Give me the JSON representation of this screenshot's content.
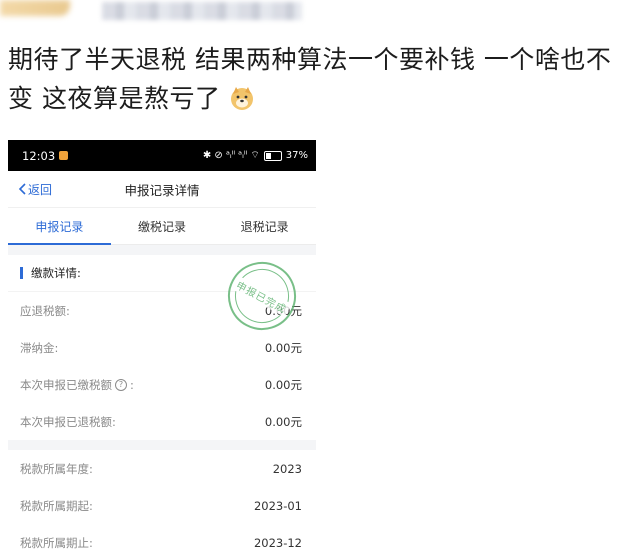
{
  "post": {
    "text": "期待了半天退税 结果两种算法一个要补钱  一个啥也不变 这夜算是熬亏了"
  },
  "statusbar": {
    "time": "12:03",
    "icons": "✱ ⊘ ᵃᵢˡˡ ᵃᵢˡˡ ⌔",
    "battery": "37%"
  },
  "navbar": {
    "back_label": "返回",
    "title": "申报记录详情"
  },
  "tabs": [
    {
      "label": "申报记录",
      "active": true
    },
    {
      "label": "缴税记录",
      "active": false
    },
    {
      "label": "退税记录",
      "active": false
    }
  ],
  "section": {
    "title": "缴款详情:"
  },
  "stamp": {
    "text": "申报已完成"
  },
  "rows": [
    {
      "key": "应退税额:",
      "value": "0.00元"
    },
    {
      "key": "滞纳金:",
      "value": "0.00元"
    },
    {
      "key": "本次申报已缴税额",
      "suffix": ":",
      "value": "0.00元"
    },
    {
      "key": "本次申报已退税额:",
      "value": "0.00元"
    }
  ],
  "rows2": [
    {
      "key": "税款所属年度:",
      "value": "2023"
    },
    {
      "key": "税款所属期起:",
      "value": "2023-01"
    },
    {
      "key": "税款所属期止:",
      "value": "2023-12"
    }
  ],
  "colors": {
    "accent": "#2d6bd6",
    "stamp": "#58b06b"
  }
}
